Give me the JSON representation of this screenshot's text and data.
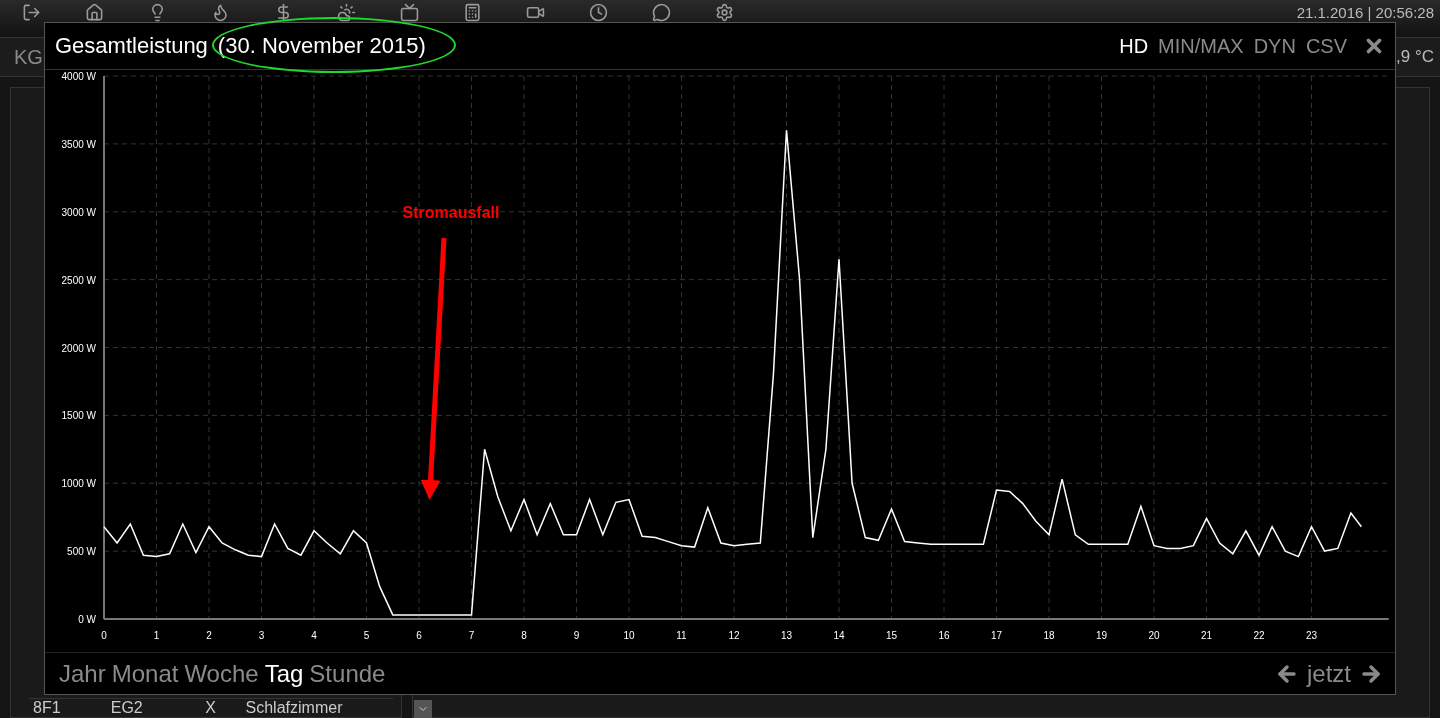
{
  "background": {
    "datetime": "21.1.2016 | 20:56:28",
    "location_tab": "KG",
    "temperature": ",9 °C",
    "table_row": [
      "8F1",
      "EG2",
      "X",
      "Schlafzimmer"
    ]
  },
  "dialog": {
    "title": "Gesamtleistung",
    "date": "(30. November 2015)",
    "date_highlighted": true,
    "options": [
      {
        "label": "HD",
        "selected": true
      },
      {
        "label": "MIN/MAX",
        "selected": false
      },
      {
        "label": "DYN",
        "selected": false
      },
      {
        "label": "CSV",
        "selected": false
      }
    ],
    "chart_data": {
      "type": "line",
      "xlim": [
        0,
        24.47
      ],
      "ylim": [
        0,
        4000
      ],
      "yticks": [
        {
          "value": 0,
          "label": "0 W"
        },
        {
          "value": 500,
          "label": "500 W"
        },
        {
          "value": 1000,
          "label": "1000 W"
        },
        {
          "value": 1500,
          "label": "1500 W"
        },
        {
          "value": 2000,
          "label": "2000 W"
        },
        {
          "value": 2500,
          "label": "2500 W"
        },
        {
          "value": 3000,
          "label": "3000 W"
        },
        {
          "value": 3500,
          "label": "3500 W"
        },
        {
          "value": 4000,
          "label": "4000 W"
        }
      ],
      "xticks": [
        0,
        1,
        2,
        3,
        4,
        5,
        6,
        7,
        8,
        9,
        10,
        11,
        12,
        13,
        14,
        15,
        16,
        17,
        18,
        19,
        20,
        21,
        22,
        23
      ],
      "x": [
        0,
        0.25,
        0.5,
        0.75,
        1,
        1.25,
        1.5,
        1.75,
        2,
        2.25,
        2.5,
        2.75,
        3,
        3.25,
        3.5,
        3.75,
        4,
        4.25,
        4.5,
        4.75,
        5,
        5.25,
        5.5,
        5.75,
        6,
        6.25,
        6.5,
        6.75,
        7,
        7.25,
        7.5,
        7.75,
        8,
        8.25,
        8.5,
        8.75,
        9,
        9.25,
        9.5,
        9.75,
        10,
        10.25,
        10.5,
        10.75,
        11,
        11.25,
        11.5,
        11.75,
        12,
        12.25,
        12.5,
        12.75,
        13,
        13.25,
        13.5,
        13.75,
        14,
        14.25,
        14.5,
        14.75,
        15,
        15.25,
        15.5,
        15.75,
        16,
        16.25,
        16.5,
        16.75,
        17,
        17.25,
        17.5,
        17.75,
        18,
        18.25,
        18.5,
        18.75,
        19,
        19.25,
        19.5,
        19.75,
        20,
        20.25,
        20.5,
        20.75,
        21,
        21.25,
        21.5,
        21.75,
        22,
        22.25,
        22.5,
        22.75,
        23,
        23.25,
        23.5,
        23.75,
        23.95
      ],
      "grid": true,
      "series": [
        {
          "color": "#ffffff",
          "values": [
            680,
            560,
            700,
            470,
            460,
            480,
            700,
            490,
            680,
            560,
            510,
            470,
            460,
            700,
            520,
            470,
            650,
            560,
            480,
            650,
            560,
            240,
            30,
            30,
            30,
            30,
            30,
            30,
            30,
            1250,
            900,
            650,
            880,
            620,
            850,
            620,
            620,
            880,
            620,
            860,
            880,
            610,
            600,
            570,
            540,
            530,
            820,
            560,
            540,
            550,
            560,
            1800,
            3600,
            2500,
            600,
            1250,
            2650,
            1000,
            600,
            580,
            810,
            570,
            560,
            550,
            550,
            550,
            550,
            550,
            950,
            940,
            850,
            720,
            620,
            1030,
            620,
            550,
            550,
            550,
            550,
            830,
            540,
            520,
            520,
            540,
            740,
            560,
            480,
            650,
            470,
            680,
            500,
            460,
            680,
            500,
            520,
            780,
            680
          ]
        }
      ],
      "annotations": [
        "Stromausfall"
      ]
    },
    "ranges": [
      {
        "label": "Jahr",
        "selected": false
      },
      {
        "label": "Monat",
        "selected": false
      },
      {
        "label": "Woche",
        "selected": false
      },
      {
        "label": "Tag",
        "selected": true
      },
      {
        "label": "Stunde",
        "selected": false
      }
    ],
    "now_label": "jetzt"
  }
}
